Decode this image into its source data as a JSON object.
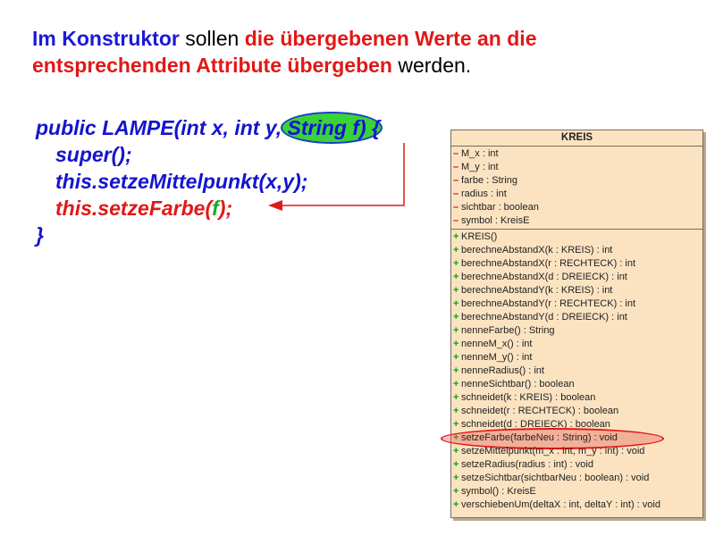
{
  "heading": {
    "parts": [
      {
        "text": "Im Konstruktor",
        "style": "blue"
      },
      {
        "text": " sollen ",
        "style": "black"
      },
      {
        "text": "die übergebenen Werte an die entsprechenden Attribute übergeben",
        "style": "red"
      },
      {
        "text": " werden.",
        "style": "black"
      }
    ]
  },
  "code": {
    "line1_prefix": "public LAMPE(int x, int y, ",
    "line1_highlight": "String f",
    "line1_suffix": ") {",
    "line2": "super();",
    "line3": "this.setzeMittelpunkt(x,y);",
    "line4_prefix": "this.setzeFarbe(",
    "line4_param": "f",
    "line4_suffix": ");",
    "line5": "}"
  },
  "uml": {
    "class_name": "KREIS",
    "attributes": [
      {
        "vis": "–",
        "text": "M_x : int"
      },
      {
        "vis": "–",
        "text": "M_y : int"
      },
      {
        "vis": "–",
        "text": "farbe : String"
      },
      {
        "vis": "–",
        "text": "radius : int"
      },
      {
        "vis": "–",
        "text": "sichtbar : boolean"
      },
      {
        "vis": "–",
        "text": "symbol : KreisE"
      }
    ],
    "methods": [
      {
        "vis": "+",
        "text": "KREIS()"
      },
      {
        "vis": "+",
        "text": "berechneAbstandX(k : KREIS) : int"
      },
      {
        "vis": "+",
        "text": "berechneAbstandX(r : RECHTECK) : int"
      },
      {
        "vis": "+",
        "text": "berechneAbstandX(d : DREIECK) : int"
      },
      {
        "vis": "+",
        "text": "berechneAbstandY(k : KREIS) : int"
      },
      {
        "vis": "+",
        "text": "berechneAbstandY(r : RECHTECK) : int"
      },
      {
        "vis": "+",
        "text": "berechneAbstandY(d : DREIECK) : int"
      },
      {
        "vis": "+",
        "text": "nenneFarbe() : String"
      },
      {
        "vis": "+",
        "text": "nenneM_x() : int"
      },
      {
        "vis": "+",
        "text": "nenneM_y() : int"
      },
      {
        "vis": "+",
        "text": "nenneRadius() : int"
      },
      {
        "vis": "+",
        "text": "nenneSichtbar() : boolean"
      },
      {
        "vis": "+",
        "text": "schneidet(k : KREIS) : boolean"
      },
      {
        "vis": "+",
        "text": "schneidet(r : RECHTECK) : boolean"
      },
      {
        "vis": "+",
        "text": "schneidet(d : DREIECK) : boolean"
      },
      {
        "vis": "+",
        "text": "setzeFarbe(farbeNeu : String) : void",
        "highlight": true
      },
      {
        "vis": "+",
        "text": "setzeMittelpunkt(m_x : int, m_y : int) : void"
      },
      {
        "vis": "+",
        "text": "setzeRadius(radius : int) : void"
      },
      {
        "vis": "+",
        "text": "setzeSichtbar(sichtbarNeu : boolean) : void"
      },
      {
        "vis": "+",
        "text": "symbol() : KreisE"
      },
      {
        "vis": "+",
        "text": "verschiebenUm(deltaX : int, deltaY : int) : void"
      }
    ]
  },
  "colors": {
    "blue": "#1a1ad8",
    "red": "#e01818",
    "green": "#1fa81f",
    "uml_bg": "#fbe3c1"
  }
}
